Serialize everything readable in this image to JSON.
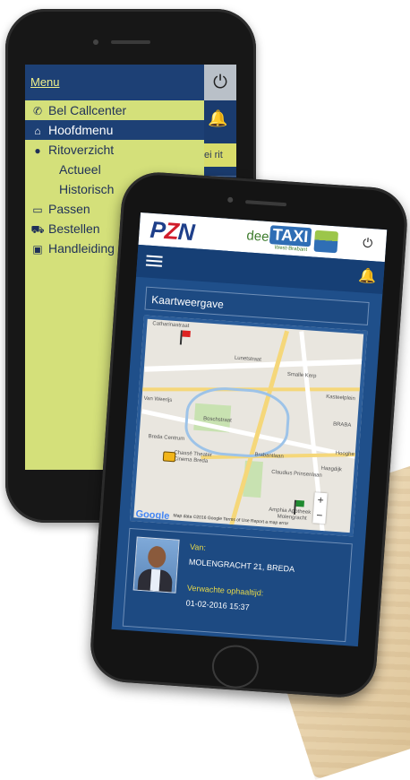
{
  "phone_back": {
    "menu_title": "Menu",
    "power_icon": "power-icon",
    "rit_button_label": "ei rit",
    "menu_items": [
      {
        "label": "Bel Callcenter",
        "icon": "phone-icon",
        "icon_glyph": "📞",
        "active": false,
        "sub": false
      },
      {
        "label": "Hoofdmenu",
        "icon": "home-icon",
        "icon_glyph": "⌂",
        "active": true,
        "sub": false
      },
      {
        "label": "Ritoverzicht",
        "icon": "location-pin-icon",
        "icon_glyph": "⬤",
        "active": false,
        "sub": false
      },
      {
        "label": "Actueel",
        "icon": "",
        "icon_glyph": "",
        "active": false,
        "sub": true
      },
      {
        "label": "Historisch",
        "icon": "",
        "icon_glyph": "",
        "active": false,
        "sub": true
      },
      {
        "label": "Passen",
        "icon": "card-icon",
        "icon_glyph": "▭",
        "active": false,
        "sub": false
      },
      {
        "label": "Bestellen",
        "icon": "car-icon",
        "icon_glyph": "⛟",
        "active": false,
        "sub": false
      },
      {
        "label": "Handleiding",
        "icon": "manual-icon",
        "icon_glyph": "▣",
        "active": false,
        "sub": false
      }
    ]
  },
  "phone_front": {
    "brand": {
      "pzn_p": "P",
      "pzn_z": "Z",
      "pzn_n": "N",
      "deel": "deel",
      "taxi": "TAXI",
      "taxi_sub": "West-Brabant"
    },
    "panel_title": "Kaartweergave",
    "map": {
      "labels": [
        "Lunetstraat",
        "Smalle Kerp",
        "Catharinastraat",
        "Breda Centrum",
        "Chassé Theater",
        "Cinema Breda",
        "Brabantlaan",
        "Claudius Prinsenlaan",
        "Haagdijk",
        "Amphia Apotheek",
        "Molengracht",
        "Boschstraat",
        "Van Weerijs",
        "Kasteelplein",
        "BRABA",
        "Hooghe"
      ],
      "footer": "Map data ©2016 Google   Terms of Use   Report a map error",
      "google": "Google",
      "zoom_in": "+",
      "zoom_out": "−"
    },
    "info": {
      "from_label": "Van:",
      "from_value": "MOLENGRACHT 21, BREDA",
      "pickup_label": "Verwachte ophaaltijd:",
      "pickup_value": "01-02-2016 15:37"
    }
  }
}
